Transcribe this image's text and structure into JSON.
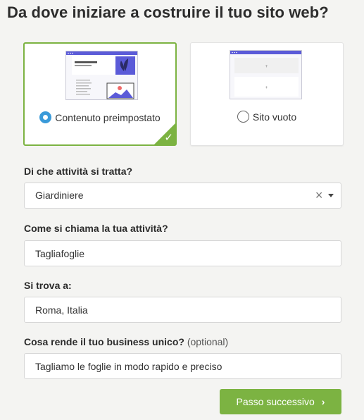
{
  "page": {
    "title": "Da dove iniziare a costruire il tuo sito web?"
  },
  "options": [
    {
      "label": "Contenuto preimpostato",
      "selected": true
    },
    {
      "label": "Sito vuoto",
      "selected": false
    }
  ],
  "form": {
    "activity": {
      "label": "Di che attività si tratta?",
      "value": "Giardiniere"
    },
    "business_name": {
      "label": "Come si chiama la tua attività?",
      "value": "Tagliafoglie"
    },
    "location": {
      "label": "Si trova a:",
      "value": "Roma, Italia"
    },
    "unique": {
      "label": "Cosa rende il tuo business unico?",
      "optional": "(optional)",
      "value": "Tagliamo le foglie in modo rapido e preciso"
    }
  },
  "buttons": {
    "next": "Passo successivo"
  },
  "colors": {
    "accent_green": "#7cb342",
    "radio_blue": "#3a9ad9",
    "thumb_purple": "#5b5bd8"
  }
}
